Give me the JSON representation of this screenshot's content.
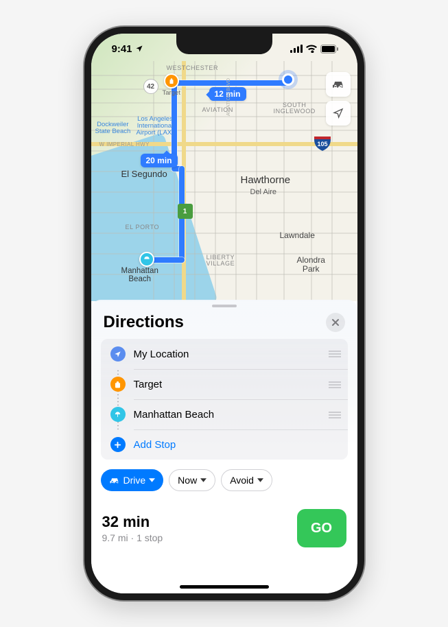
{
  "status": {
    "time": "9:41"
  },
  "map": {
    "labels": {
      "westchester": "WESTCHESTER",
      "aviation": "AVIATION",
      "south_inglewood": "SOUTH\nINGLEWOOD",
      "el_segundo": "El Segundo",
      "hawthorne": "Hawthorne",
      "del_aire": "Del Aire",
      "el_porto": "EL PORTO",
      "lawndale": "Lawndale",
      "liberty_village": "LIBERTY\nVILLAGE",
      "alondra_park": "Alondra\nPark",
      "manhattan_beach": "Manhattan\nBeach",
      "dockweiler": "Dockweiler\nState Beach",
      "lax": "Los Angeles\nInternational\nAirport (LAX)",
      "imperial": "W IMPERIAL HWY",
      "aviation_blvd": "AVIATION BLVD",
      "target": "Target"
    },
    "shields": {
      "r42": "42",
      "r1": "1",
      "i105": "105"
    },
    "times": {
      "t1": "12 min",
      "t2": "20 min"
    }
  },
  "sheet": {
    "title": "Directions",
    "stops": [
      {
        "label": "My Location",
        "icon": "location",
        "color": "#5b8def"
      },
      {
        "label": "Target",
        "icon": "bag",
        "color": "#ff9500"
      },
      {
        "label": "Manhattan Beach",
        "icon": "umbrella",
        "color": "#31c5e7"
      }
    ],
    "add_stop": "Add Stop",
    "options": {
      "drive": "Drive",
      "now": "Now",
      "avoid": "Avoid"
    },
    "eta": {
      "time": "32 min",
      "sub": "9.7 mi · 1 stop"
    },
    "go": "GO"
  }
}
